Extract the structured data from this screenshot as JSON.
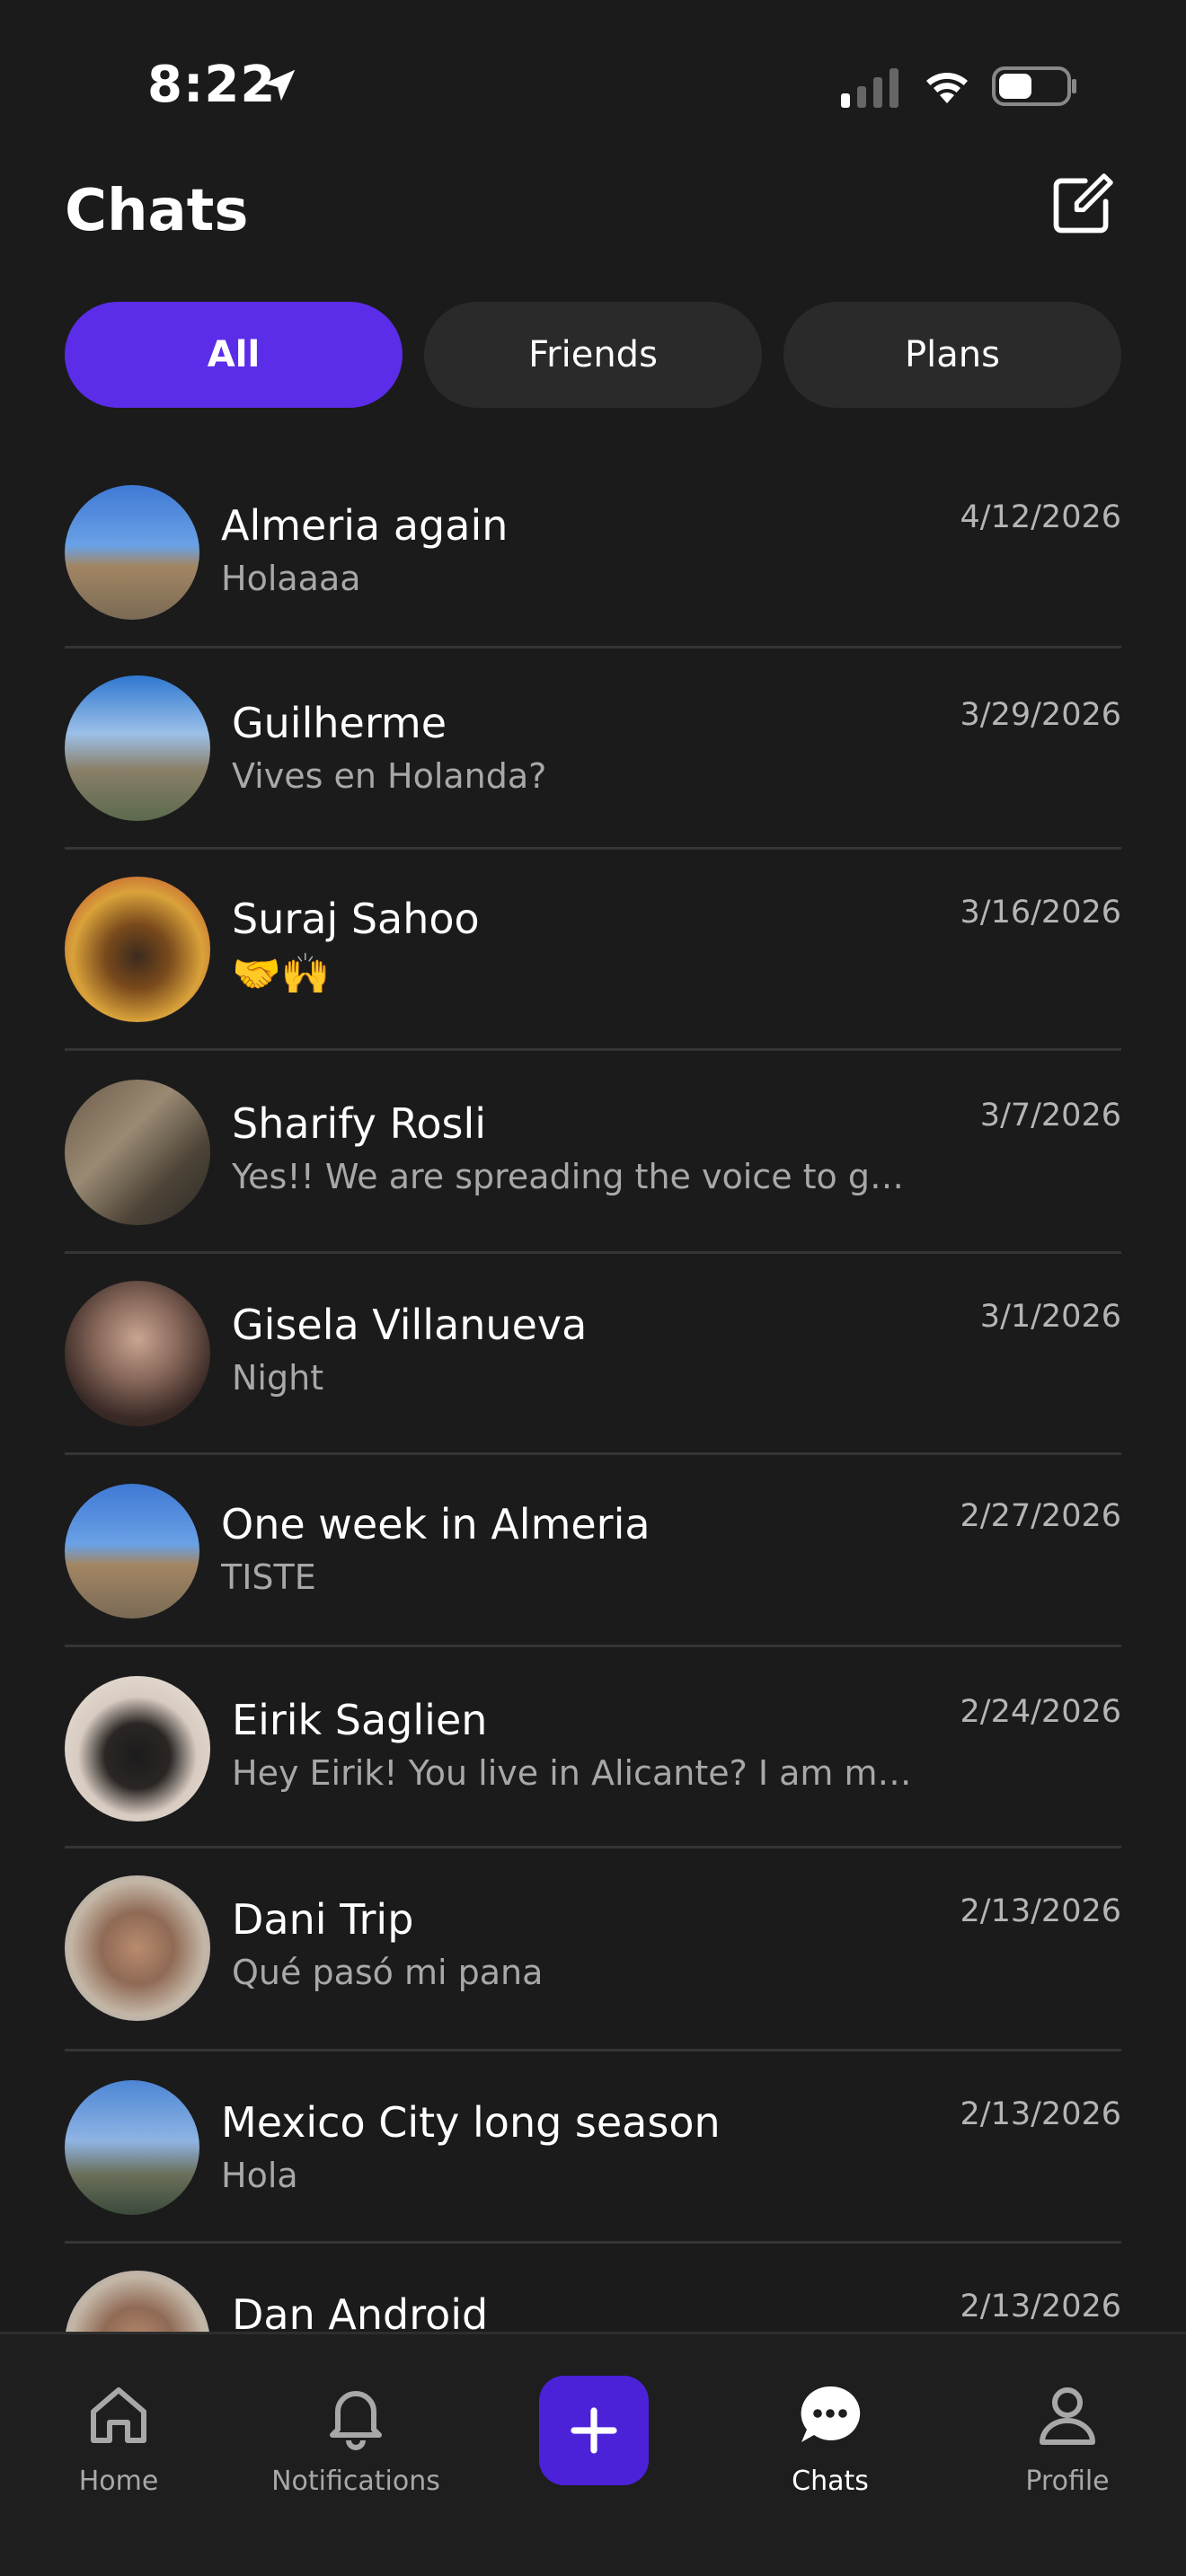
{
  "status_bar": {
    "time": "8:22"
  },
  "header": {
    "title": "Chats",
    "compose_icon": "compose-icon"
  },
  "filters": [
    {
      "label": "All",
      "active": true
    },
    {
      "label": "Friends",
      "active": false
    },
    {
      "label": "Plans",
      "active": false
    }
  ],
  "chats": [
    {
      "name": "Almeria again",
      "message": "Holaaaa",
      "date": "4/12/2026",
      "group": true
    },
    {
      "name": "Guilherme",
      "message": "Vives en Holanda?",
      "date": "3/29/2026",
      "group": false
    },
    {
      "name": "Suraj Sahoo",
      "message": "🤝🙌",
      "date": "3/16/2026",
      "group": false
    },
    {
      "name": "Sharify Rosli",
      "message": "Yes!! We are spreading the voice to get...",
      "date": "3/7/2026",
      "group": false
    },
    {
      "name": "Gisela Villanueva",
      "message": "Night",
      "date": "3/1/2026",
      "group": false
    },
    {
      "name": "One week in Almeria",
      "message": "TISTE",
      "date": "2/27/2026",
      "group": true
    },
    {
      "name": "Eirik Saglien",
      "message": "Hey Eirik! You live in Alicante? I am mov...",
      "date": "2/24/2026",
      "group": false
    },
    {
      "name": "Dani Trip",
      "message": "Qué pasó mi pana",
      "date": "2/13/2026",
      "group": false
    },
    {
      "name": "Mexico City long season",
      "message": "Hola",
      "date": "2/13/2026",
      "group": true
    },
    {
      "name": "Dan Android",
      "message": "",
      "date": "2/13/2026",
      "group": false
    }
  ],
  "bottom_nav": {
    "home": "Home",
    "notifications": "Notifications",
    "chats": "Chats",
    "profile": "Profile",
    "active": "chats"
  },
  "colors": {
    "accent": "#5b2de8",
    "background": "#1b1b1b",
    "pill": "#2a2a2a"
  }
}
